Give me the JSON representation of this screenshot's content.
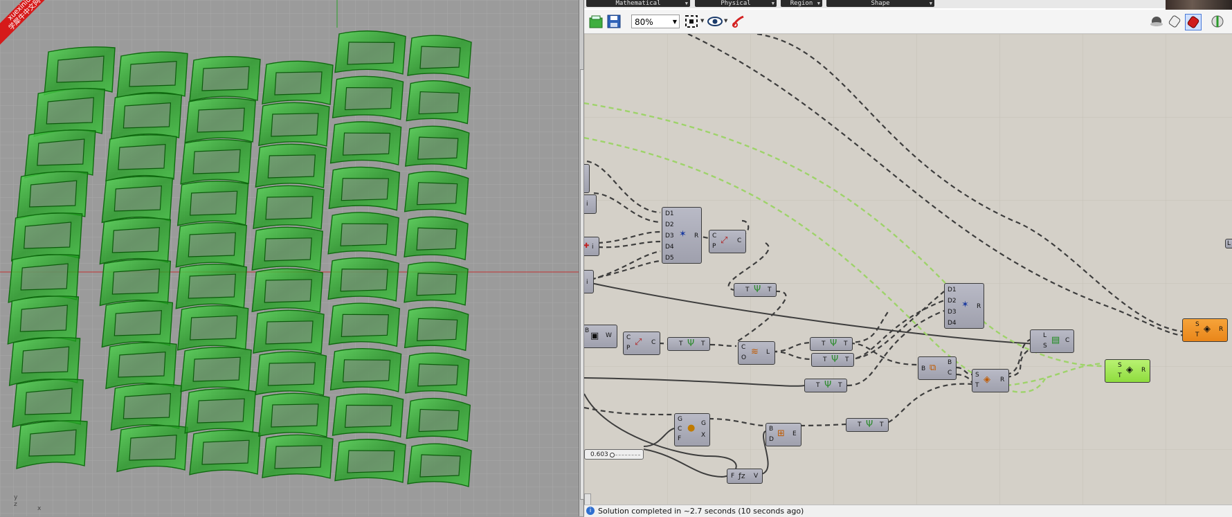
{
  "watermark": {
    "line1": "xuexiniu",
    "line2": "学犀牛中文网"
  },
  "viewport": {
    "axis_labels": [
      "y",
      "z",
      "x"
    ]
  },
  "tabs": [
    {
      "label": "Mathematical"
    },
    {
      "label": "Physical"
    },
    {
      "label": "Region"
    },
    {
      "label": "Shape"
    }
  ],
  "toolbar": {
    "zoom_value": "80%",
    "icons": [
      "open-file-icon",
      "save-icon",
      "zoom-extents-icon",
      "preview-eye-icon",
      "sketch-pen-icon",
      "preview-wire-icon",
      "preview-shaded-icon",
      "preview-selected-icon"
    ]
  },
  "canvas": {
    "slider_value": "0.603",
    "nodes": {
      "merge1": {
        "inputs": [
          "D1",
          "D2",
          "D3",
          "D4",
          "D5"
        ],
        "outputs": [
          "R"
        ]
      },
      "move1": {
        "inputs": [
          "C",
          "P"
        ],
        "outputs": [
          "C"
        ]
      },
      "graft1": {
        "inputs": [
          "T"
        ],
        "outputs": [
          "T"
        ]
      },
      "box1": {
        "inputs": [
          "B"
        ],
        "outputs": [
          "W"
        ]
      },
      "move2": {
        "inputs": [
          "C",
          "P"
        ],
        "outputs": [
          "C"
        ]
      },
      "graft2": {
        "inputs": [
          "T"
        ],
        "outputs": [
          "T"
        ]
      },
      "loft1": {
        "inputs": [
          "C",
          "O"
        ],
        "outputs": [
          "L"
        ]
      },
      "graft3": {
        "inputs": [
          "T"
        ],
        "outputs": [
          "T"
        ]
      },
      "graft4": {
        "inputs": [
          "T"
        ],
        "outputs": [
          "T"
        ]
      },
      "graft5": {
        "inputs": [
          "T"
        ],
        "outputs": [
          "T"
        ]
      },
      "merge2": {
        "inputs": [
          "D1",
          "D2",
          "D3",
          "D4"
        ],
        "outputs": [
          "R"
        ]
      },
      "brep1": {
        "inputs": [
          "B"
        ],
        "outputs": [
          "B",
          "C"
        ]
      },
      "split1": {
        "inputs": [
          "S",
          "T"
        ],
        "outputs": [
          "R"
        ]
      },
      "list1": {
        "inputs": [
          "L",
          "S"
        ],
        "outputs": [
          "C"
        ]
      },
      "orange1": {
        "inputs": [
          "S",
          "T"
        ],
        "outputs": [
          "R"
        ]
      },
      "green1": {
        "inputs": [
          "S",
          "T"
        ],
        "outputs": [
          "R"
        ]
      },
      "scale1": {
        "inputs": [
          "G",
          "C",
          "F"
        ],
        "outputs": [
          "G",
          "X"
        ]
      },
      "explode1": {
        "inputs": [
          "B",
          "D"
        ],
        "outputs": [
          "E"
        ]
      },
      "graft6": {
        "inputs": [
          "T"
        ],
        "outputs": [
          "T"
        ]
      },
      "fz1": {
        "inputs": [
          "F"
        ],
        "outputs": [
          "V"
        ]
      },
      "edge_i1": {
        "outputs": [
          "i"
        ]
      },
      "edge_i2": {
        "outputs": [
          "i"
        ]
      },
      "edge_i3": {
        "outputs": [
          "i"
        ]
      },
      "edge_l": {
        "outputs": [
          "L"
        ]
      }
    }
  },
  "status": {
    "text": "Solution completed in ~2.7 seconds (10 seconds ago)"
  },
  "colors": {
    "canvas_bg": "#d4d0c8",
    "viewport_bg": "#9b9b9b",
    "geometry_green": "#2fb52f",
    "wire_dark": "#3d3d3d",
    "wire_highlight": "#9ed36a"
  }
}
